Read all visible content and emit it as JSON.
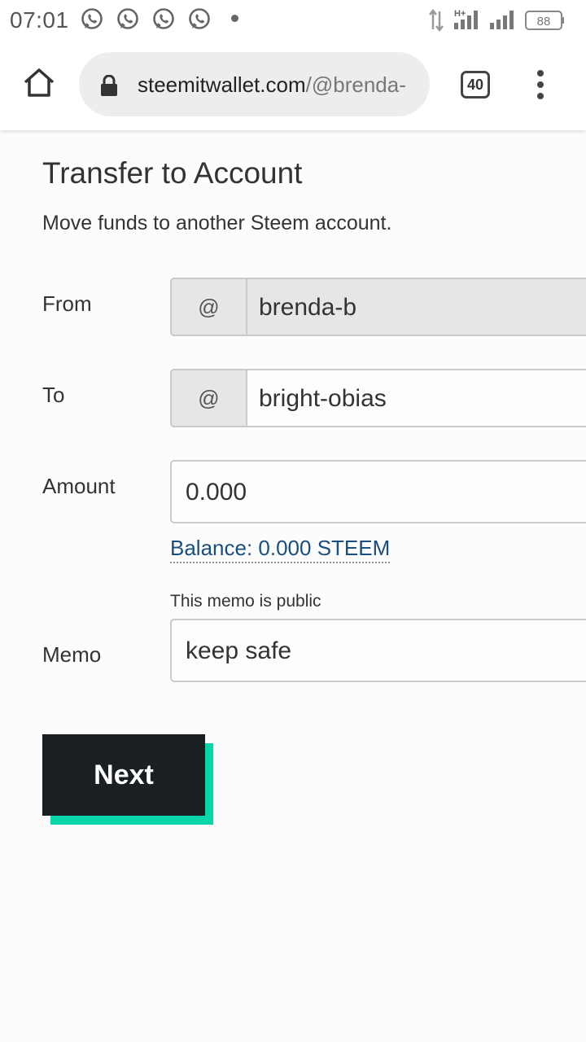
{
  "status_bar": {
    "time": "07:01",
    "notification_icons": [
      "whatsapp-icon",
      "whatsapp-icon",
      "whatsapp-icon",
      "whatsapp-icon"
    ],
    "network_label": "H+",
    "battery": "88"
  },
  "browser": {
    "url_domain": "steemitwallet.com",
    "url_path": "/@brenda-",
    "tab_count": "40"
  },
  "page": {
    "title": "Transfer to Account",
    "subtitle": "Move funds to another Steem account."
  },
  "form": {
    "from": {
      "label": "From",
      "prefix": "@",
      "value": "brenda-b"
    },
    "to": {
      "label": "To",
      "prefix": "@",
      "value": "bright-obias"
    },
    "amount": {
      "label": "Amount",
      "value": "0.000"
    },
    "balance": "Balance: 0.000 STEEM",
    "memo": {
      "label": "Memo",
      "note": "This memo is public",
      "value": "keep safe"
    },
    "next_label": "Next"
  },
  "colors": {
    "accent_shadow": "#06d6a9",
    "button_bg": "#1a1f24",
    "link": "#1a4e7e"
  }
}
